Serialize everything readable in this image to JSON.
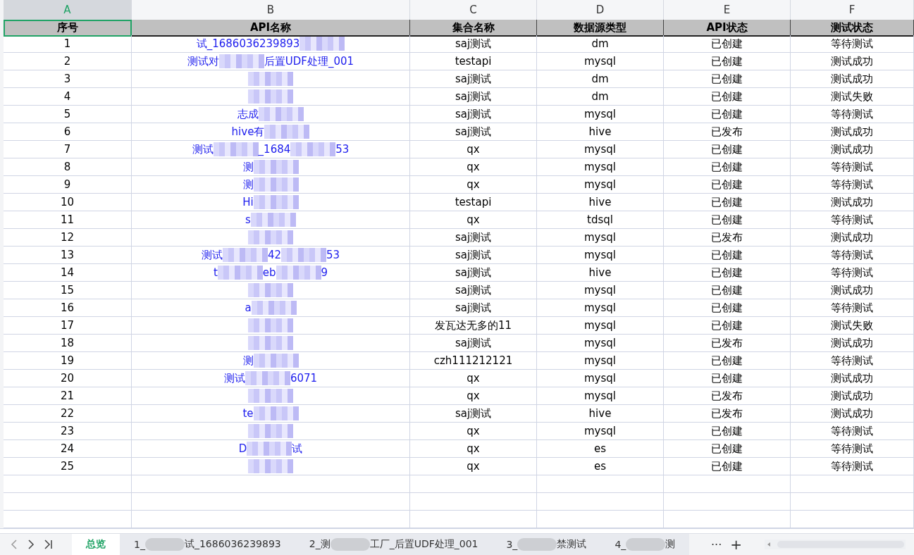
{
  "column_letters": [
    {
      "label": "A",
      "selected": true
    },
    {
      "label": "B",
      "selected": false
    },
    {
      "label": "C",
      "selected": false
    },
    {
      "label": "D",
      "selected": false
    },
    {
      "label": "E",
      "selected": false
    },
    {
      "label": "F",
      "selected": false
    }
  ],
  "header": [
    "序号",
    "API名称",
    "集合名称",
    "数据源类型",
    "API状态",
    "测试状态"
  ],
  "rows": [
    {
      "no": "1",
      "api_name_parts": [
        "试_1686036239893"
      ],
      "collection": "saj测试",
      "source": "dm",
      "api_status": "已创建",
      "test_status": "等待测试"
    },
    {
      "no": "2",
      "api_name_parts": [
        "测试对",
        "后置UDF处理_001"
      ],
      "collection": "testapi",
      "source": "mysql",
      "api_status": "已创建",
      "test_status": "测试成功"
    },
    {
      "no": "3",
      "api_name_parts": [],
      "collection": "saj测试",
      "source": "dm",
      "api_status": "已创建",
      "test_status": "测试成功"
    },
    {
      "no": "4",
      "api_name_parts": [],
      "collection": "saj测试",
      "source": "dm",
      "api_status": "已创建",
      "test_status": "测试失败"
    },
    {
      "no": "5",
      "api_name_parts": [
        "志成"
      ],
      "collection": "saj测试",
      "source": "mysql",
      "api_status": "已创建",
      "test_status": "等待测试"
    },
    {
      "no": "6",
      "api_name_parts": [
        "hive有"
      ],
      "collection": "saj测试",
      "source": "hive",
      "api_status": "已发布",
      "test_status": "测试成功"
    },
    {
      "no": "7",
      "api_name_parts": [
        "测试",
        "_1684",
        "53"
      ],
      "collection": "qx",
      "source": "mysql",
      "api_status": "已创建",
      "test_status": "测试成功"
    },
    {
      "no": "8",
      "api_name_parts": [
        "测"
      ],
      "collection": "qx",
      "source": "mysql",
      "api_status": "已创建",
      "test_status": "等待测试"
    },
    {
      "no": "9",
      "api_name_parts": [
        "测"
      ],
      "collection": "qx",
      "source": "mysql",
      "api_status": "已创建",
      "test_status": "等待测试"
    },
    {
      "no": "10",
      "api_name_parts": [
        "Hi"
      ],
      "collection": "testapi",
      "source": "hive",
      "api_status": "已创建",
      "test_status": "测试成功"
    },
    {
      "no": "11",
      "api_name_parts": [
        "s"
      ],
      "collection": "qx",
      "source": "tdsql",
      "api_status": "已创建",
      "test_status": "等待测试"
    },
    {
      "no": "12",
      "api_name_parts": [],
      "collection": "saj测试",
      "source": "mysql",
      "api_status": "已发布",
      "test_status": "测试成功"
    },
    {
      "no": "13",
      "api_name_parts": [
        "测试",
        "42",
        "53"
      ],
      "collection": "saj测试",
      "source": "mysql",
      "api_status": "已创建",
      "test_status": "等待测试"
    },
    {
      "no": "14",
      "api_name_parts": [
        "t",
        "eb",
        "9"
      ],
      "collection": "saj测试",
      "source": "hive",
      "api_status": "已创建",
      "test_status": "等待测试"
    },
    {
      "no": "15",
      "api_name_parts": [],
      "collection": "saj测试",
      "source": "mysql",
      "api_status": "已创建",
      "test_status": "测试成功"
    },
    {
      "no": "16",
      "api_name_parts": [
        "a"
      ],
      "collection": "saj测试",
      "source": "mysql",
      "api_status": "已创建",
      "test_status": "等待测试"
    },
    {
      "no": "17",
      "api_name_parts": [],
      "collection": "发瓦达无多的11",
      "source": "mysql",
      "api_status": "已创建",
      "test_status": "测试失败"
    },
    {
      "no": "18",
      "api_name_parts": [],
      "collection": "saj测试",
      "source": "mysql",
      "api_status": "已发布",
      "test_status": "测试成功"
    },
    {
      "no": "19",
      "api_name_parts": [
        "测"
      ],
      "collection": "czh111212121",
      "source": "mysql",
      "api_status": "已创建",
      "test_status": "等待测试"
    },
    {
      "no": "20",
      "api_name_parts": [
        "测试",
        "6071"
      ],
      "collection": "qx",
      "source": "mysql",
      "api_status": "已创建",
      "test_status": "测试成功"
    },
    {
      "no": "21",
      "api_name_parts": [],
      "collection": "qx",
      "source": "mysql",
      "api_status": "已发布",
      "test_status": "测试成功"
    },
    {
      "no": "22",
      "api_name_parts": [
        "te"
      ],
      "collection": "saj测试",
      "source": "hive",
      "api_status": "已发布",
      "test_status": "测试成功"
    },
    {
      "no": "23",
      "api_name_parts": [],
      "collection": "qx",
      "source": "mysql",
      "api_status": "已创建",
      "test_status": "等待测试"
    },
    {
      "no": "24",
      "api_name_parts": [
        "D",
        "试"
      ],
      "collection": "qx",
      "source": "es",
      "api_status": "已创建",
      "test_status": "等待测试"
    },
    {
      "no": "25",
      "api_name_parts": [],
      "collection": "qx",
      "source": "es",
      "api_status": "已创建",
      "test_status": "等待测试"
    }
  ],
  "sheet_tabs": [
    {
      "label_parts": [
        "总览"
      ],
      "selected": true
    },
    {
      "label_parts": [
        "1_",
        "试_1686036239893"
      ],
      "selected": false
    },
    {
      "label_parts": [
        "2_测",
        "工厂_后置UDF处理_001"
      ],
      "selected": false
    },
    {
      "label_parts": [
        "3_",
        "禁测试"
      ],
      "selected": false
    },
    {
      "label_parts": [
        "4_",
        "测"
      ],
      "selected": false
    }
  ],
  "more_tabs": "···",
  "add_tab": "+"
}
